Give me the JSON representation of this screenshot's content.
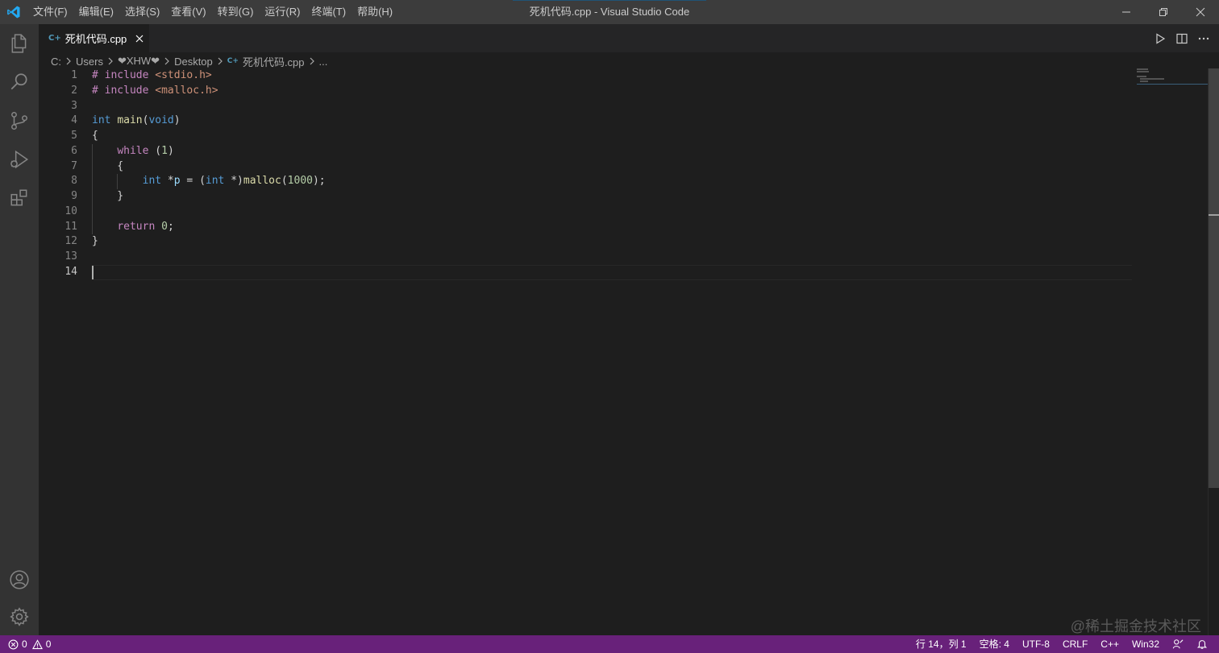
{
  "window": {
    "title": "死机代码.cpp - Visual Studio Code",
    "menu": [
      "文件(F)",
      "编辑(E)",
      "选择(S)",
      "查看(V)",
      "转到(G)",
      "运行(R)",
      "终端(T)",
      "帮助(H)"
    ]
  },
  "activity_bar": [
    "explorer-icon",
    "search-icon",
    "source-control-icon",
    "run-debug-icon",
    "extensions-icon",
    "account-icon",
    "settings-gear-icon"
  ],
  "tab": {
    "label": "死机代码.cpp",
    "file_icon": "C+"
  },
  "breadcrumb": {
    "c1": "C:",
    "c2": "Users",
    "c3": "❤XHW❤",
    "c4": "Desktop",
    "c5": "死机代码.cpp",
    "c6": "..."
  },
  "editor": {
    "line_numbers": [
      "1",
      "2",
      "3",
      "4",
      "5",
      "6",
      "7",
      "8",
      "9",
      "10",
      "11",
      "12",
      "13",
      "14"
    ],
    "current_line": 14,
    "lines": [
      [
        {
          "t": "# include ",
          "c": "kw"
        },
        {
          "t": "<stdio.h>",
          "c": "str"
        }
      ],
      [
        {
          "t": "# include ",
          "c": "kw"
        },
        {
          "t": "<malloc.h>",
          "c": "str"
        }
      ],
      [],
      [
        {
          "t": "int",
          "c": "ty"
        },
        {
          "t": " "
        },
        {
          "t": "main",
          "c": "fn"
        },
        {
          "t": "("
        },
        {
          "t": "void",
          "c": "ty"
        },
        {
          "t": ")"
        }
      ],
      [
        {
          "t": "{"
        }
      ],
      [
        {
          "t": "    "
        },
        {
          "t": "while",
          "c": "kw"
        },
        {
          "t": " ("
        },
        {
          "t": "1",
          "c": "num"
        },
        {
          "t": ")"
        }
      ],
      [
        {
          "t": "    {"
        }
      ],
      [
        {
          "t": "        "
        },
        {
          "t": "int",
          "c": "ty"
        },
        {
          "t": " *"
        },
        {
          "t": "p",
          "c": "var"
        },
        {
          "t": " = ("
        },
        {
          "t": "int",
          "c": "ty"
        },
        {
          "t": " *)"
        },
        {
          "t": "malloc",
          "c": "fn"
        },
        {
          "t": "("
        },
        {
          "t": "1000",
          "c": "num"
        },
        {
          "t": ");"
        }
      ],
      [
        {
          "t": "    }"
        }
      ],
      [],
      [
        {
          "t": "    "
        },
        {
          "t": "return",
          "c": "kw"
        },
        {
          "t": " "
        },
        {
          "t": "0",
          "c": "num"
        },
        {
          "t": ";"
        }
      ],
      [
        {
          "t": "}"
        }
      ],
      [],
      []
    ]
  },
  "watermark": "@稀土掘金技术社区",
  "status_bar": {
    "errors": "0",
    "warnings": "0",
    "position": "行 14，列 1",
    "indent": "空格: 4",
    "encoding": "UTF-8",
    "eol": "CRLF",
    "language": "C++",
    "platform": "Win32"
  },
  "colors": {
    "status_bar": "#68217a",
    "title_bar": "#3c3c3c",
    "activity_bar": "#333333",
    "editor_bg": "#1e1e1e",
    "vscode_blue": "#23a9f2"
  }
}
